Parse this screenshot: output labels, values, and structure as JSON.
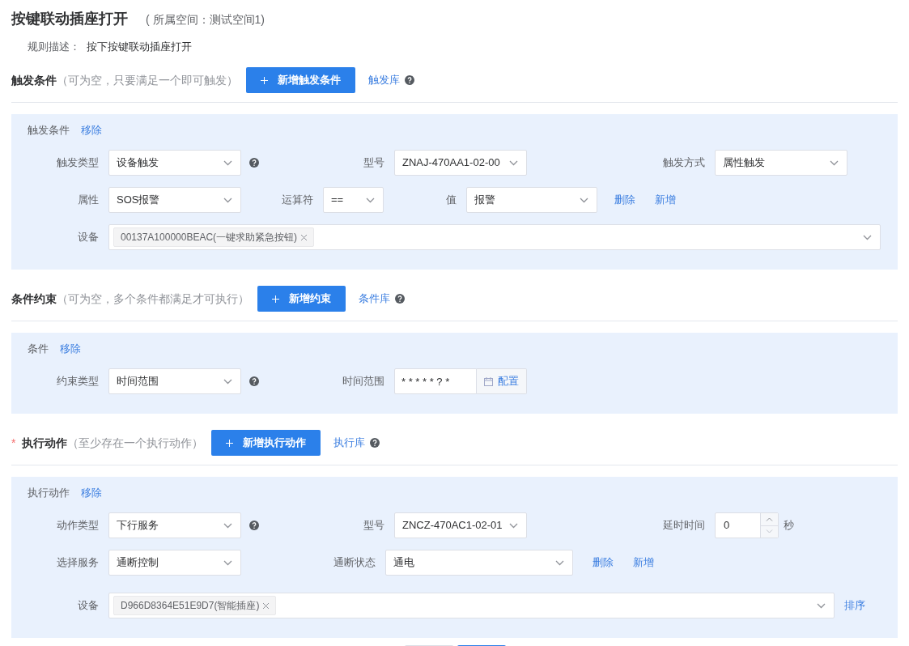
{
  "title": "按键联动插座打开",
  "space": "( 所属空间：测试空间1)",
  "description": {
    "label": "规则描述：",
    "text": "按下按键联动插座打开"
  },
  "sections": [
    {
      "title": "触发条件",
      "hint": "（可为空，只要满足一个即可触发）",
      "add_button": "新增触发条件",
      "library_link": "触发库",
      "panel": {
        "title": "触发条件",
        "remove": "移除",
        "rows": [
          {
            "fields": [
              {
                "kind": "select",
                "label": "触发类型",
                "value": "设备触发"
              },
              {
                "kind": "help"
              },
              {
                "kind": "select",
                "label": "型号",
                "value": "ZNAJ-470AA1-02-00"
              },
              {
                "kind": "select",
                "label": "触发方式",
                "value": "属性触发"
              }
            ]
          },
          {
            "fields": [
              {
                "kind": "select",
                "label": "属性",
                "value": "SOS报警"
              },
              {
                "kind": "select",
                "label": "运算符",
                "value": "=="
              },
              {
                "kind": "select",
                "label": "值",
                "value": "报警"
              },
              {
                "kind": "links",
                "links": [
                  "删除",
                  "新增"
                ]
              }
            ]
          },
          {
            "fields": [
              {
                "kind": "tags",
                "label": "设备",
                "tags": [
                  "00137A100000BEAC(一键求助紧急按钮)"
                ]
              }
            ]
          }
        ]
      }
    },
    {
      "title": "条件约束",
      "hint": "（可为空，多个条件都满足才可执行）",
      "add_button": "新增约束",
      "library_link": "条件库",
      "panel": {
        "title": "条件",
        "remove": "移除",
        "rows": [
          {
            "fields": [
              {
                "kind": "select",
                "label": "约束类型",
                "value": "时间范围"
              },
              {
                "kind": "help"
              },
              {
                "kind": "time",
                "label": "时间范围",
                "value": "* * * * * ? *",
                "button": "配置"
              }
            ]
          }
        ]
      }
    },
    {
      "required_mark": "*",
      "title": "执行动作",
      "hint": "（至少存在一个执行动作）",
      "add_button": "新增执行动作",
      "library_link": "执行库",
      "panel": {
        "title": "执行动作",
        "remove": "移除",
        "rows": [
          {
            "fields": [
              {
                "kind": "select",
                "label": "动作类型",
                "value": "下行服务"
              },
              {
                "kind": "help"
              },
              {
                "kind": "select",
                "label": "型号",
                "value": "ZNCZ-470AC1-02-01"
              },
              {
                "kind": "number",
                "label": "延时时间",
                "value": "0",
                "unit": "秒"
              }
            ]
          },
          {
            "fields": [
              {
                "kind": "select",
                "label": "选择服务",
                "value": "通断控制"
              },
              {
                "kind": "select",
                "label": "通断状态",
                "value": "通电"
              },
              {
                "kind": "links",
                "links": [
                  "删除",
                  "新增"
                ]
              }
            ]
          },
          {
            "fields": [
              {
                "kind": "tags",
                "label": "设备",
                "tags": [
                  "D966D8364E51E9D7(智能插座)"
                ]
              },
              {
                "kind": "links",
                "links": [
                  "排序"
                ]
              }
            ]
          }
        ]
      }
    }
  ]
}
